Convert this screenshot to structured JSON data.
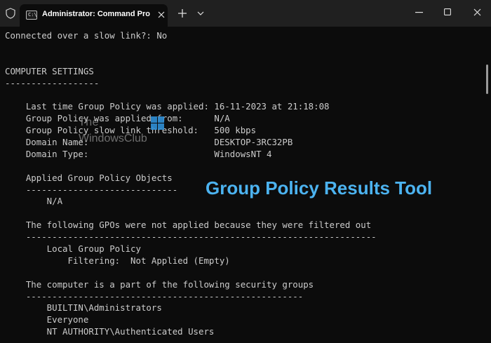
{
  "titlebar": {
    "tab_title": "Administrator: Command Pro",
    "tab_icon_text": "C:\\",
    "colors": {
      "titlebar_bg": "#202020",
      "tab_bg": "#0c0c0c"
    }
  },
  "console": {
    "lines": [
      "Connected over a slow link?: No",
      "",
      "",
      "COMPUTER SETTINGS",
      "------------------",
      "",
      "    Last time Group Policy was applied: 16-11-2023 at 21:18:08",
      "    Group Policy was applied from:      N/A",
      "    Group Policy slow link threshold:   500 kbps",
      "    Domain Name:                        DESKTOP-3RC32PB",
      "    Domain Type:                        WindowsNT 4",
      "",
      "    Applied Group Policy Objects",
      "    -----------------------------",
      "        N/A",
      "",
      "    The following GPOs were not applied because they were filtered out",
      "    -------------------------------------------------------------------",
      "        Local Group Policy",
      "            Filtering:  Not Applied (Empty)",
      "",
      "    The computer is a part of the following security groups",
      "    -----------------------------------------------------",
      "        BUILTIN\\Administrators",
      "        Everyone",
      "        NT AUTHORITY\\Authenticated Users"
    ],
    "colors": {
      "background": "#0c0c0c",
      "text": "#cccccc"
    }
  },
  "watermark": {
    "line1": "The",
    "line2": "WindowsClub"
  },
  "overlay": {
    "caption": "Group Policy Results Tool",
    "color": "#4cb3f0"
  }
}
